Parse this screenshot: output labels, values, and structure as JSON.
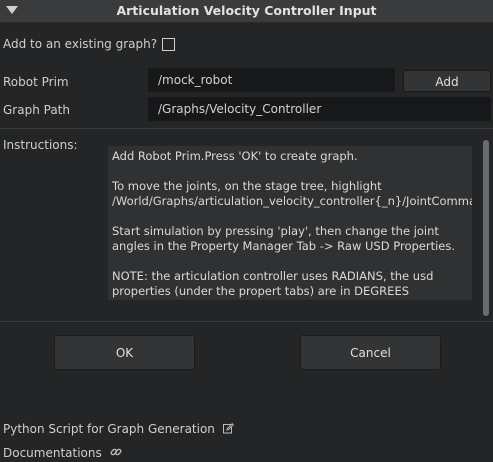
{
  "window": {
    "title": "Articulation Velocity Controller Input"
  },
  "form": {
    "add_existing_label": "Add to an existing graph?",
    "add_existing_checked": false,
    "robot_prim_label": "Robot Prim",
    "robot_prim_value": "/mock_robot",
    "add_button_label": "Add",
    "graph_path_label": "Graph Path",
    "graph_path_value": "/Graphs/Velocity_Controller"
  },
  "instructions": {
    "label": "Instructions:",
    "paragraphs": [
      "Add Robot Prim.Press 'OK' to create graph.",
      " To move the joints, on the stage tree, highlight /World/Graphs/articulation_velocity_controller{_n}/JointCommandArray,",
      " Start simulation by pressing 'play', then change the joint angles in the Property Manager Tab -> Raw USD Properties.",
      " NOTE: the articulation controller uses RADIANS, the usd properties (under the propert tabs) are in DEGREES"
    ]
  },
  "actions": {
    "ok_label": "OK",
    "cancel_label": "Cancel"
  },
  "footer": {
    "python_script_label": "Python Script for Graph Generation",
    "documentations_label": "Documentations"
  },
  "icons": {
    "collapse": "chevron-down-icon",
    "edit": "edit-icon",
    "link": "link-icon"
  }
}
